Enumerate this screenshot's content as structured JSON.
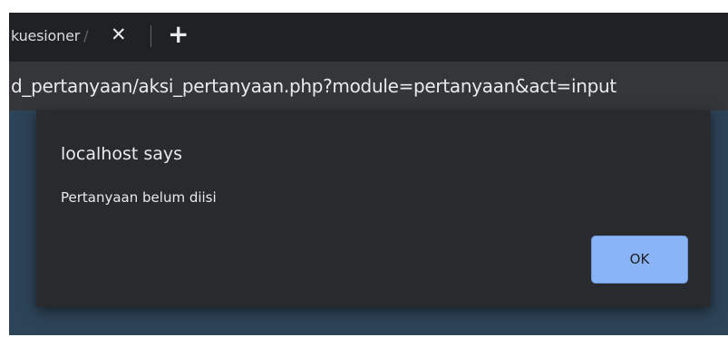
{
  "tab": {
    "title": "kuesioner",
    "separator": "/",
    "close_glyph": "✕",
    "close_icon": "close-icon",
    "new_tab_glyph": "+",
    "new_tab_icon": "plus-icon"
  },
  "address_bar": {
    "url": "d_pertanyaan/aksi_pertanyaan.php?module=pertanyaan&act=input"
  },
  "dialog": {
    "title": "localhost says",
    "message": "Pertanyaan belum diisi",
    "ok_label": "OK"
  },
  "colors": {
    "tabbar_bg": "#202124",
    "toolbar_bg": "#35363a",
    "page_bg": "#2d4457",
    "dialog_bg": "#292a2d",
    "button_accent": "#8ab4f8"
  }
}
